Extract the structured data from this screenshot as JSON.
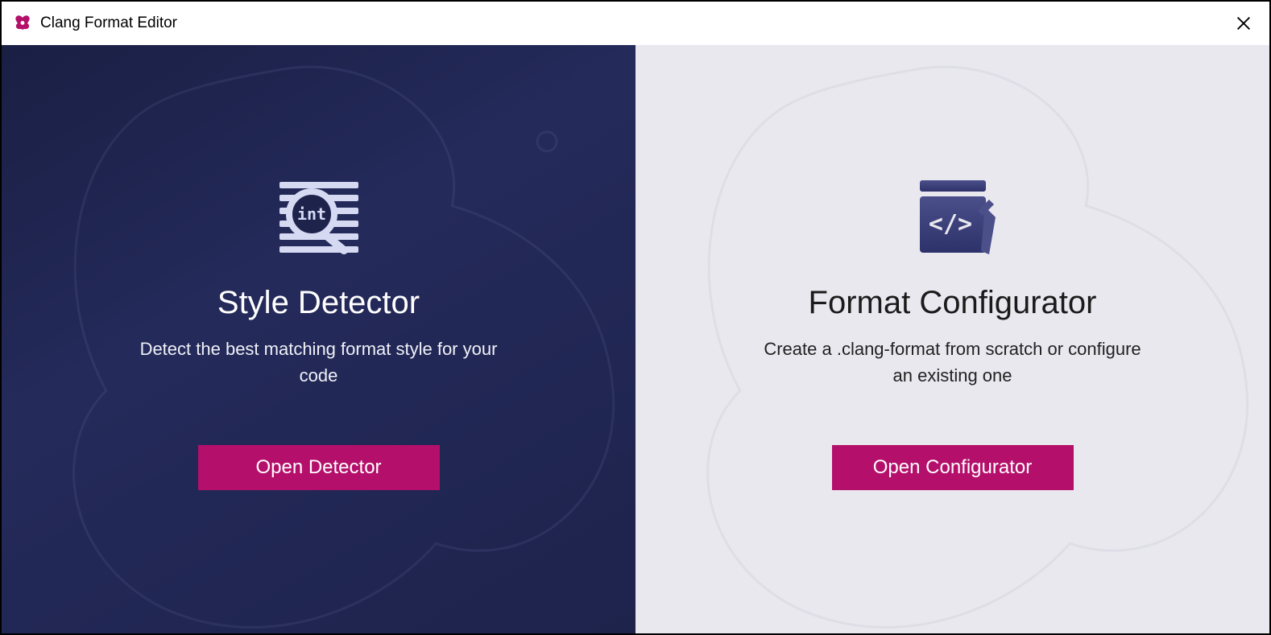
{
  "window": {
    "title": "Clang Format Editor"
  },
  "left_panel": {
    "heading": "Style Detector",
    "description": "Detect the best matching format style for your code",
    "button_label": "Open Detector"
  },
  "right_panel": {
    "heading": "Format Configurator",
    "description": "Create a .clang-format from scratch or configure an existing one",
    "button_label": "Open Configurator"
  },
  "colors": {
    "accent": "#b40f6a",
    "dark_bg": "#1e234c",
    "light_bg": "#e9e8ef"
  }
}
